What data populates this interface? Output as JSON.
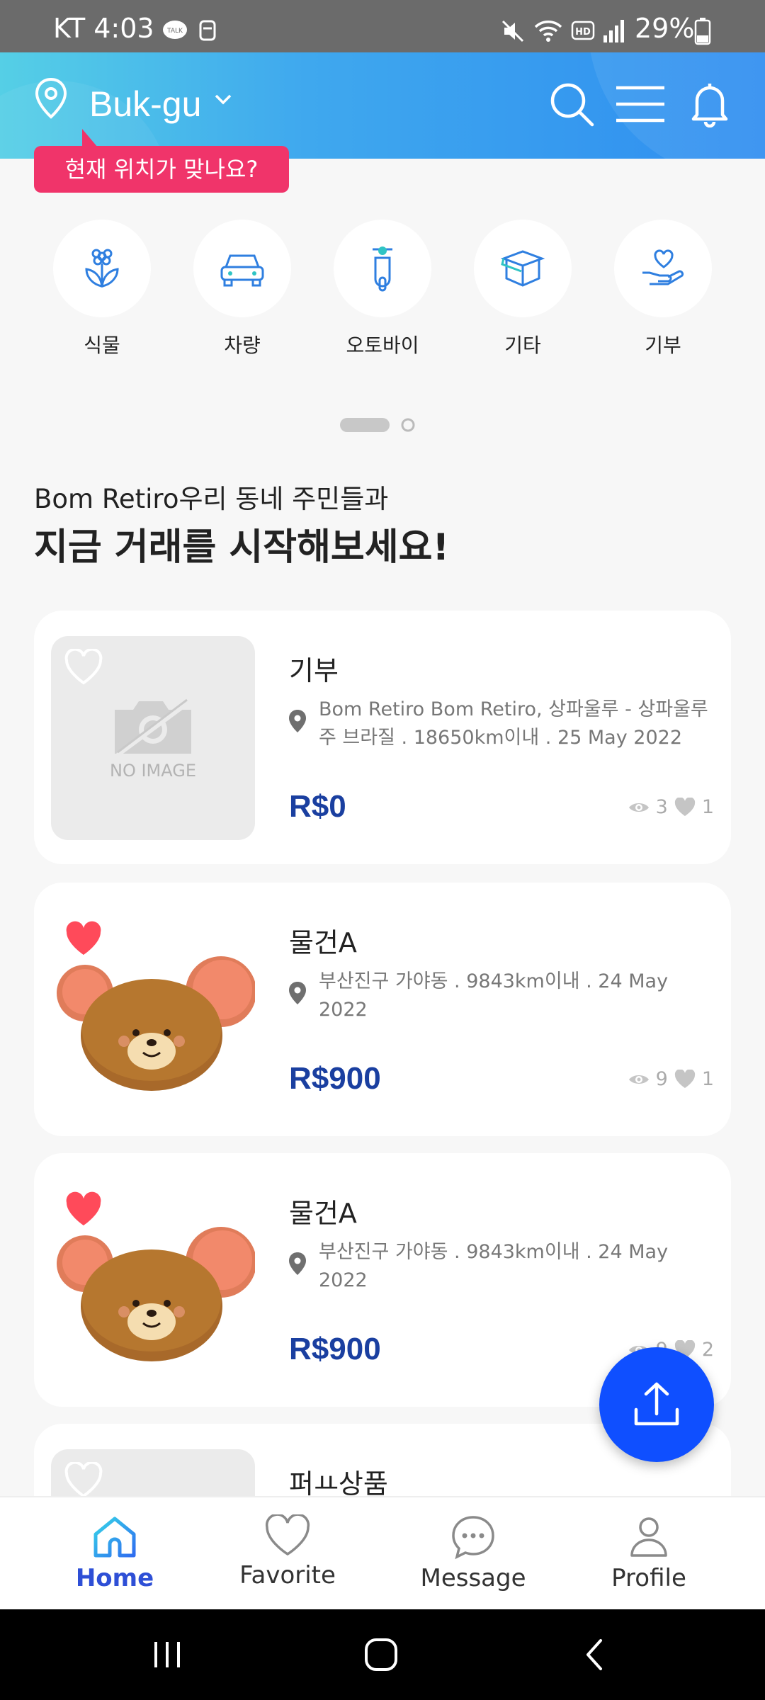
{
  "status_bar": {
    "time": "KT 4:03",
    "battery": "29%"
  },
  "header": {
    "location": "Buk-gu",
    "tooltip": "현재 위치가 맞나요?"
  },
  "categories": [
    {
      "label": "식물",
      "icon": "plant-icon"
    },
    {
      "label": "차량",
      "icon": "car-icon"
    },
    {
      "label": "오토바이",
      "icon": "scooter-icon"
    },
    {
      "label": "기타",
      "icon": "box-icon"
    },
    {
      "label": "기부",
      "icon": "donation-icon"
    }
  ],
  "intro": {
    "line1": "Bom Retiro우리 동네 주민들과",
    "line2": "지금 거래를 시작해보세요!"
  },
  "listings": [
    {
      "title": "기부",
      "address": "Bom Retiro Bom Retiro, 상파울루 - 상파울루 주 브라질 . 18650km이내 . 25 May 2022",
      "price": "R$0",
      "views": "3",
      "likes": "1",
      "image": "NO IMAGE",
      "favorited": false
    },
    {
      "title": "물건A",
      "address": "부산진구 가야동 . 9843km이내 . 24 May 2022",
      "price": "R$900",
      "views": "9",
      "likes": "1",
      "favorited": true
    },
    {
      "title": "물건A",
      "address": "부산진구 가야동 . 9843km이내 . 24 May 2022",
      "price": "R$900",
      "views": "9",
      "likes": "2",
      "favorited": true
    },
    {
      "title": "퍼ㅛ상품"
    }
  ],
  "bottom_nav": [
    {
      "label": "Home",
      "icon": "home-icon",
      "active": true
    },
    {
      "label": "Favorite",
      "icon": "heart-icon"
    },
    {
      "label": "Message",
      "icon": "chat-icon"
    },
    {
      "label": "Profile",
      "icon": "person-icon"
    }
  ],
  "colors": {
    "accent": "#2e4fd6",
    "price": "#1a3fa0",
    "tooltip": "#f0346a",
    "fab": "#0f4fff"
  }
}
